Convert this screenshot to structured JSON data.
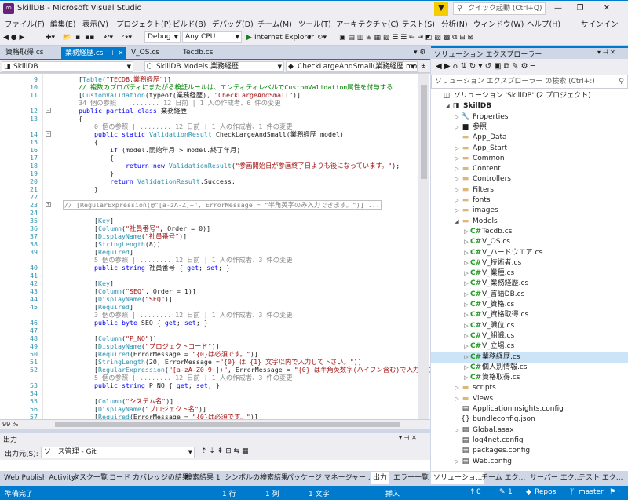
{
  "window": {
    "title": "SkillDB - Microsoft Visual Studio",
    "quick_launch_placeholder": "クイック起動 (Ctrl+Q)",
    "controls": [
      "—",
      "❐",
      "✕"
    ]
  },
  "menu": {
    "items": [
      "ファイル(F)",
      "編集(E)",
      "表示(V)",
      "プロジェクト(P)",
      "ビルド(B)",
      "デバッグ(D)",
      "チーム(M)",
      "ツール(T)",
      "アーキテクチャ(C)",
      "テスト(S)",
      "分析(N)",
      "ウィンドウ(W)",
      "ヘルプ(H)"
    ],
    "signin": "サインイン"
  },
  "toolbar": {
    "config": "Debug",
    "platform": "Any CPU",
    "browser": "Internet Explorer"
  },
  "editor": {
    "tabs": [
      "資格取得.cs",
      "業務経歴.cs",
      "V_OS.cs",
      "Tecdb.cs"
    ],
    "active_tab": "業務経歴.cs",
    "nav": {
      "project": "SkillDB",
      "class": "SkillDB.Models.業務経歴",
      "member": "CheckLargeAndSmall(業務経歴 model)"
    },
    "zoom": "99 %",
    "lines": [
      {
        "n": "9",
        "t": "    [Table(\"TECDB.業務経歴\")]"
      },
      {
        "n": "10",
        "t": "    // 複数のプロパティにまたがる検証ルールは、エンティティレベルでCustomValidation属性を付与する"
      },
      {
        "n": "11",
        "t": "    [CustomValidation(typeof(業務経歴), \"CheckLargeAndSmall\")]"
      },
      {
        "n": "",
        "t": "    34 個の参照 | ........ 12 日前 | 1 人の作成者、6 件の変更"
      },
      {
        "n": "12",
        "t": "    public partial class 業務経歴"
      },
      {
        "n": "13",
        "t": "    {"
      },
      {
        "n": "",
        "t": "        0 個の参照 | ........ 12 日前 | 1 人の作成者、1 件の変更"
      },
      {
        "n": "14",
        "t": "        public static ValidationResult CheckLargeAndSmall(業務経歴 model)"
      },
      {
        "n": "15",
        "t": "        {"
      },
      {
        "n": "16",
        "t": "            if (model.開始年月 > model.終了年月)"
      },
      {
        "n": "17",
        "t": "            {"
      },
      {
        "n": "18",
        "t": "                return new ValidationResult(\"参画開始日が参画終了日よりも後になっています。\");"
      },
      {
        "n": "19",
        "t": "            }"
      },
      {
        "n": "20",
        "t": "            return ValidationResult.Success;"
      },
      {
        "n": "21",
        "t": "        }"
      },
      {
        "n": "22",
        "t": ""
      },
      {
        "n": "23",
        "t": "        // [RegularExpression(@\"[a-zA-Z]+\", ErrorMessage = \"半角英字のみ入力できます。\")] ..."
      },
      {
        "n": "24",
        "t": ""
      },
      {
        "n": "35",
        "t": "        [Key]"
      },
      {
        "n": "36",
        "t": "        [Column(\"社員番号\", Order = 0)]"
      },
      {
        "n": "37",
        "t": "        [DisplayName(\"社員番号\")]"
      },
      {
        "n": "38",
        "t": "        [StringLength(8)]"
      },
      {
        "n": "39",
        "t": "        [Required]"
      },
      {
        "n": "",
        "t": "        5 個の参照 | ........ 12 日前 | 1 人の作成者、3 件の変更"
      },
      {
        "n": "40",
        "t": "        public string 社員番号 { get; set; }"
      },
      {
        "n": "41",
        "t": ""
      },
      {
        "n": "42",
        "t": "        [Key]"
      },
      {
        "n": "43",
        "t": "        [Column(\"SEQ\", Order = 1)]"
      },
      {
        "n": "44",
        "t": "        [DisplayName(\"SEQ\")]"
      },
      {
        "n": "45",
        "t": "        [Required]"
      },
      {
        "n": "",
        "t": "        3 個の参照 | ........ 12 日前 | 1 人の作成者、3 件の変更"
      },
      {
        "n": "46",
        "t": "        public byte SEQ { get; set; }"
      },
      {
        "n": "47",
        "t": ""
      },
      {
        "n": "48",
        "t": "        [Column(\"P_NO\")]"
      },
      {
        "n": "49",
        "t": "        [DisplayName(\"プロジェクトコード\")]"
      },
      {
        "n": "50",
        "t": "        [Required(ErrorMessage = \"{0}は必須です。\")]"
      },
      {
        "n": "51",
        "t": "        [StringLength(20, ErrorMessage =\"{0} は {1} 文字以内で入力して下さい。\")]"
      },
      {
        "n": "52",
        "t": "        [RegularExpression(\"[a-zA-Z0-9-]+\", ErrorMessage = \"{0} は半角英数字(ハイフン含む)で入力して下さい。\")]"
      },
      {
        "n": "",
        "t": "        5 個の参照 | ........ 12 日前 | 1 人の作成者、3 件の変更"
      },
      {
        "n": "53",
        "t": "        public string P_NO { get; set; }"
      },
      {
        "n": "54",
        "t": ""
      },
      {
        "n": "55",
        "t": "        [Column(\"システム名\")]"
      },
      {
        "n": "56",
        "t": "        [DisplayName(\"プロジェクト名\")]"
      },
      {
        "n": "57",
        "t": "        [Required(ErrorMessage = \"{0}は必須です。\")]"
      },
      {
        "n": "58",
        "t": "        [StringLength(100, ErrorMessage = \"{0} は {1} 文字以内で入力して下さい。\")]"
      },
      {
        "n": "",
        "t": "        5 個の参照 | ........ 12 日前 | 1 人の作成者、3 件の変更"
      },
      {
        "n": "59",
        "t": "        public string システム名 { get; set; }"
      },
      {
        "n": "60",
        "t": ""
      }
    ]
  },
  "output": {
    "title": "出力",
    "source_label": "出力元(S):",
    "source_value": "ソース管理 - Git"
  },
  "bottom_tabs": [
    "Web Publish Activity",
    "タスク一覧",
    "コード カバレッジの結果",
    "検索結果 1",
    "シンボルの検索結果",
    "パッケージ マネージャー...",
    "出力",
    "エラー一覧",
    "ソリューショ...",
    "チーム エク...",
    "サーバー エク...",
    "テスト エク..."
  ],
  "status": {
    "left": "準備完了",
    "line": "1 行",
    "col": "1 列",
    "ch": "1 文字",
    "mode": "挿入",
    "up": "0",
    "pencil": "1",
    "repos": "Repos",
    "branch": "master"
  },
  "solution_explorer": {
    "title": "ソリューション エクスプローラー",
    "search_placeholder": "ソリューション エクスプローラー の検索 (Ctrl+:)",
    "nodes": [
      {
        "label": "ソリューション 'SkillDB' (2 プロジェクト)",
        "level": 0,
        "exp": "",
        "icon": "sln"
      },
      {
        "label": "SkillDB",
        "level": 1,
        "exp": "◢",
        "icon": "proj"
      },
      {
        "label": "Properties",
        "level": 2,
        "exp": "▷",
        "icon": "wrench"
      },
      {
        "label": "参照",
        "level": 2,
        "exp": "▷",
        "icon": "ref"
      },
      {
        "label": "App_Data",
        "level": 2,
        "exp": "",
        "icon": "folder"
      },
      {
        "label": "App_Start",
        "level": 2,
        "exp": "▷",
        "icon": "folder"
      },
      {
        "label": "Common",
        "level": 2,
        "exp": "▷",
        "icon": "folder"
      },
      {
        "label": "Content",
        "level": 2,
        "exp": "▷",
        "icon": "folder"
      },
      {
        "label": "Controllers",
        "level": 2,
        "exp": "▷",
        "icon": "folder"
      },
      {
        "label": "Filters",
        "level": 2,
        "exp": "▷",
        "icon": "folder"
      },
      {
        "label": "fonts",
        "level": 2,
        "exp": "▷",
        "icon": "folder"
      },
      {
        "label": "images",
        "level": 2,
        "exp": "▷",
        "icon": "folder"
      },
      {
        "label": "Models",
        "level": 2,
        "exp": "◢",
        "icon": "folder"
      },
      {
        "label": "Tecdb.cs",
        "level": 3,
        "exp": "▷",
        "icon": "cs"
      },
      {
        "label": "V_OS.cs",
        "level": 3,
        "exp": "▷",
        "icon": "cs"
      },
      {
        "label": "V_ハードウエア.cs",
        "level": 3,
        "exp": "▷",
        "icon": "cs"
      },
      {
        "label": "V_技術者.cs",
        "level": 3,
        "exp": "▷",
        "icon": "cs"
      },
      {
        "label": "V_業種.cs",
        "level": 3,
        "exp": "▷",
        "icon": "cs"
      },
      {
        "label": "V_業務経歴.cs",
        "level": 3,
        "exp": "▷",
        "icon": "cs"
      },
      {
        "label": "V_言語DB.cs",
        "level": 3,
        "exp": "▷",
        "icon": "cs"
      },
      {
        "label": "V_資格.cs",
        "level": 3,
        "exp": "▷",
        "icon": "cs"
      },
      {
        "label": "V_資格取得.cs",
        "level": 3,
        "exp": "▷",
        "icon": "cs"
      },
      {
        "label": "V_職位.cs",
        "level": 3,
        "exp": "▷",
        "icon": "cs"
      },
      {
        "label": "V_組織.cs",
        "level": 3,
        "exp": "▷",
        "icon": "cs"
      },
      {
        "label": "V_立場.cs",
        "level": 3,
        "exp": "▷",
        "icon": "cs"
      },
      {
        "label": "業務経歴.cs",
        "level": 3,
        "exp": "▷",
        "icon": "cs",
        "selected": true
      },
      {
        "label": "個人別情報.cs",
        "level": 3,
        "exp": "▷",
        "icon": "cs"
      },
      {
        "label": "資格取得.cs",
        "level": 3,
        "exp": "▷",
        "icon": "cs"
      },
      {
        "label": "scripts",
        "level": 2,
        "exp": "▷",
        "icon": "folder"
      },
      {
        "label": "Views",
        "level": 2,
        "exp": "▷",
        "icon": "folder"
      },
      {
        "label": "ApplicationInsights.config",
        "level": 2,
        "exp": "",
        "icon": "cfg"
      },
      {
        "label": "bundleconfig.json",
        "level": 2,
        "exp": "",
        "icon": "json"
      },
      {
        "label": "Global.asax",
        "level": 2,
        "exp": "▷",
        "icon": "cfg"
      },
      {
        "label": "log4net.config",
        "level": 2,
        "exp": "",
        "icon": "cfg"
      },
      {
        "label": "packages.config",
        "level": 2,
        "exp": "",
        "icon": "cfg"
      },
      {
        "label": "Web.config",
        "level": 2,
        "exp": "▷",
        "icon": "cfg"
      }
    ]
  }
}
